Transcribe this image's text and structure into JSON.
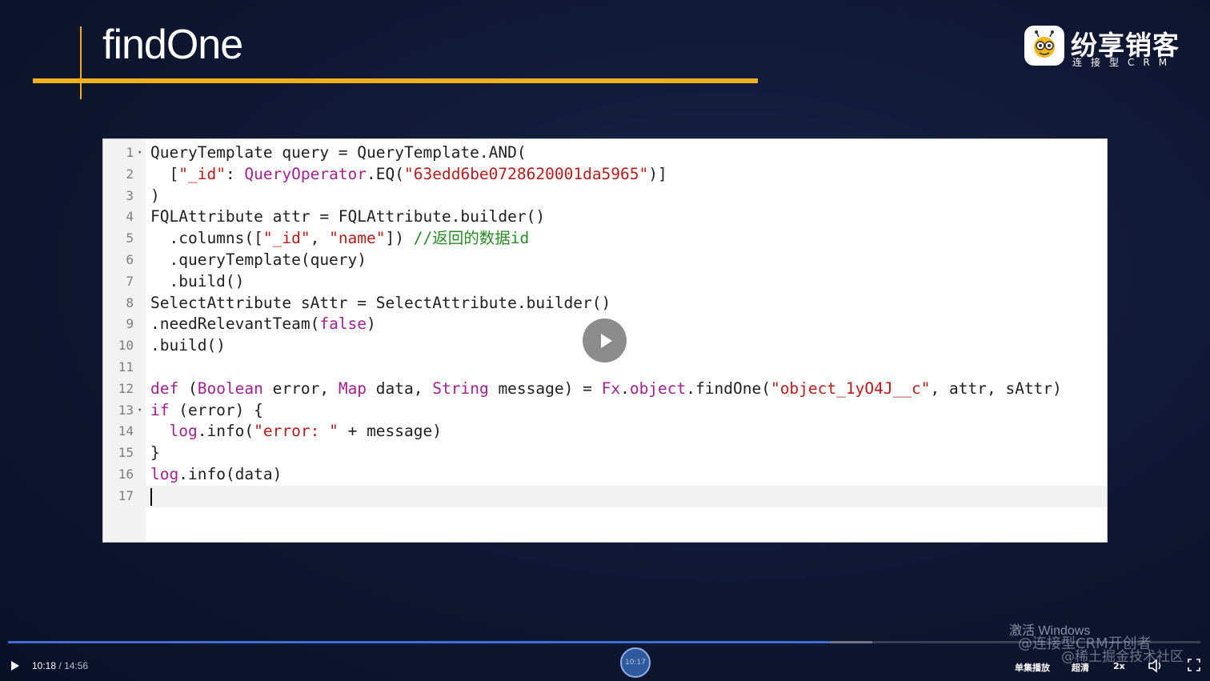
{
  "slide": {
    "title": "findOne",
    "logo_name": "纷享销客",
    "logo_tagline": "连接型CRM"
  },
  "editor": {
    "lines": [
      {
        "num": "1",
        "fold": true,
        "tokens": [
          {
            "t": "QueryTemplate query = QueryTemplate.AND("
          }
        ]
      },
      {
        "num": "2",
        "fold": false,
        "tokens": [
          {
            "t": "  ["
          },
          {
            "t": "\"_id\"",
            "c": "str"
          },
          {
            "t": ": "
          },
          {
            "t": "QueryOperator",
            "c": "kw"
          },
          {
            "t": ".EQ("
          },
          {
            "t": "\"63edd6be0728620001da5965\"",
            "c": "str"
          },
          {
            "t": ")]"
          }
        ]
      },
      {
        "num": "3",
        "fold": false,
        "tokens": [
          {
            "t": ")"
          }
        ]
      },
      {
        "num": "4",
        "fold": false,
        "tokens": [
          {
            "t": "FQLAttribute attr = FQLAttribute.builder()"
          }
        ]
      },
      {
        "num": "5",
        "fold": false,
        "tokens": [
          {
            "t": "  .columns(["
          },
          {
            "t": "\"_id\"",
            "c": "str"
          },
          {
            "t": ", "
          },
          {
            "t": "\"name\"",
            "c": "str"
          },
          {
            "t": "]) "
          },
          {
            "t": "//返回的数据id",
            "c": "cmt"
          }
        ]
      },
      {
        "num": "6",
        "fold": false,
        "tokens": [
          {
            "t": "  .queryTemplate(query)"
          }
        ]
      },
      {
        "num": "7",
        "fold": false,
        "tokens": [
          {
            "t": "  .build()"
          }
        ]
      },
      {
        "num": "8",
        "fold": false,
        "tokens": [
          {
            "t": "SelectAttribute sAttr = SelectAttribute.builder()"
          }
        ]
      },
      {
        "num": "9",
        "fold": false,
        "tokens": [
          {
            "t": ".needRelevantTeam("
          },
          {
            "t": "false",
            "c": "kw"
          },
          {
            "t": ")"
          }
        ]
      },
      {
        "num": "10",
        "fold": false,
        "tokens": [
          {
            "t": ".build()"
          }
        ]
      },
      {
        "num": "11",
        "fold": false,
        "tokens": [
          {
            "t": ""
          }
        ]
      },
      {
        "num": "12",
        "fold": false,
        "tokens": [
          {
            "t": "def",
            "c": "kw"
          },
          {
            "t": " ("
          },
          {
            "t": "Boolean",
            "c": "kw"
          },
          {
            "t": " error, "
          },
          {
            "t": "Map",
            "c": "kw"
          },
          {
            "t": " data, "
          },
          {
            "t": "String",
            "c": "kw"
          },
          {
            "t": " message) = "
          },
          {
            "t": "Fx",
            "c": "kw"
          },
          {
            "t": "."
          },
          {
            "t": "object",
            "c": "kw"
          },
          {
            "t": ".findOne("
          },
          {
            "t": "\"object_1yO4J__c\"",
            "c": "str"
          },
          {
            "t": ", attr, sAttr)"
          }
        ]
      },
      {
        "num": "13",
        "fold": true,
        "tokens": [
          {
            "t": "if",
            "c": "kw"
          },
          {
            "t": " (error) {"
          }
        ]
      },
      {
        "num": "14",
        "fold": false,
        "tokens": [
          {
            "t": "  "
          },
          {
            "t": "log",
            "c": "kw"
          },
          {
            "t": ".info("
          },
          {
            "t": "\"error: \"",
            "c": "str"
          },
          {
            "t": " + message)"
          }
        ]
      },
      {
        "num": "15",
        "fold": false,
        "tokens": [
          {
            "t": "}"
          }
        ]
      },
      {
        "num": "16",
        "fold": false,
        "tokens": [
          {
            "t": "log",
            "c": "kw"
          },
          {
            "t": ".info(data)"
          }
        ]
      },
      {
        "num": "17",
        "fold": false,
        "active": true,
        "tokens": [
          {
            "t": ""
          }
        ]
      }
    ],
    "colors": {
      "keyword": "#a0238b",
      "string": "#b41d1d",
      "comment": "#2a8a27",
      "text": "#202020"
    }
  },
  "watermarks": {
    "windows": "激活 Windows",
    "line1": "@连接型CRM开创者",
    "line2": "@稀土掘金技术社区"
  },
  "player": {
    "current_time": "10:18",
    "duration": "14:56",
    "thumb_time": "10:17",
    "progress_fraction": 0.689,
    "buffered_fraction": 0.725,
    "single_play_label": "单集播放",
    "quality_label": "超清",
    "speed_label": "2x",
    "accent_color": "#3b6fd6"
  }
}
